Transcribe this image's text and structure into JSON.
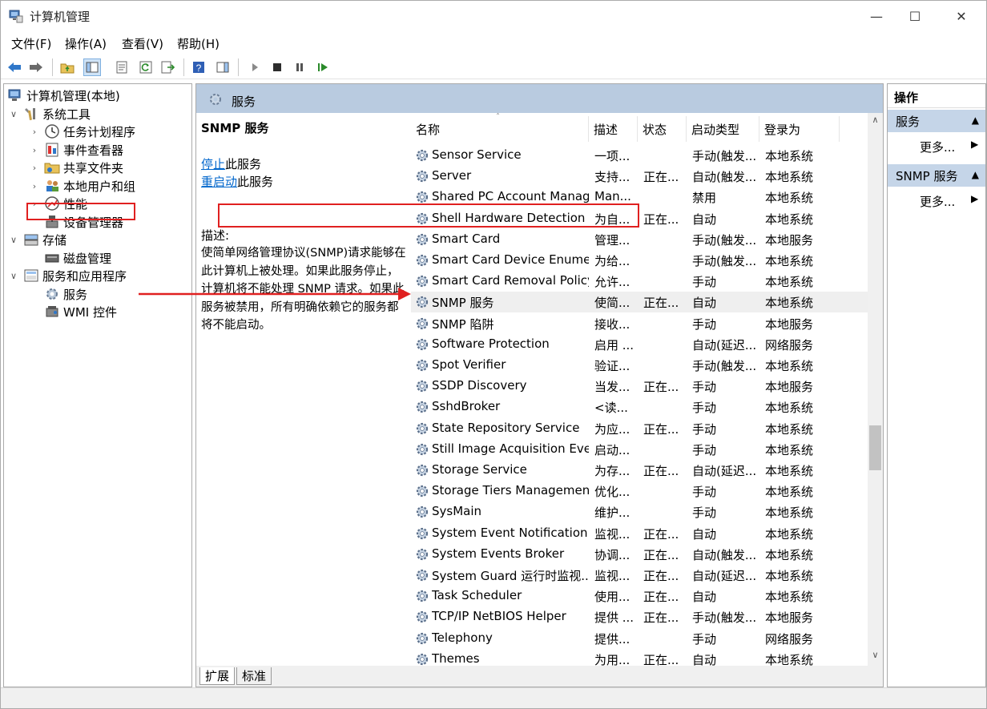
{
  "window": {
    "title": "计算机管理",
    "minimize": "—",
    "maximize": "☐",
    "close": "✕"
  },
  "menu": [
    "文件(F)",
    "操作(A)",
    "查看(V)",
    "帮助(H)"
  ],
  "tree": {
    "root": "计算机管理(本地)",
    "system_tools": "系统工具",
    "task_scheduler": "任务计划程序",
    "event_viewer": "事件查看器",
    "shared_folders": "共享文件夹",
    "local_users": "本地用户和组",
    "performance": "性能",
    "device_manager": "设备管理器",
    "storage": "存储",
    "disk_management": "磁盘管理",
    "services_apps": "服务和应用程序",
    "services": "服务",
    "wmi": "WMI 控件"
  },
  "center": {
    "header": "服务",
    "service_name": "SNMP 服务",
    "stop_link": "停止",
    "stop_rest": "此服务",
    "restart_link": "重启动",
    "restart_rest": "此服务",
    "desc_label": "描述:",
    "description": "使简单网络管理协议(SNMP)请求能够在此计算机上被处理。如果此服务停止，计算机将不能处理 SNMP 请求。如果此服务被禁用，所有明确依赖它的服务都将不能启动。"
  },
  "columns": [
    "名称",
    "描述",
    "状态",
    "启动类型",
    "登录为"
  ],
  "services": [
    [
      "Sensor Service",
      "一项...",
      "",
      "手动(触发...",
      "本地系统"
    ],
    [
      "Server",
      "支持...",
      "正在...",
      "自动(触发...",
      "本地系统"
    ],
    [
      "Shared PC Account Manager",
      "Man...",
      "",
      "禁用",
      "本地系统"
    ],
    [
      "Shell Hardware Detection",
      "为自...",
      "正在...",
      "自动",
      "本地系统"
    ],
    [
      "Smart Card",
      "管理...",
      "",
      "手动(触发...",
      "本地服务"
    ],
    [
      "Smart Card Device Enumer...",
      "为给...",
      "",
      "手动(触发...",
      "本地系统"
    ],
    [
      "Smart Card Removal Policy",
      "允许...",
      "",
      "手动",
      "本地系统"
    ],
    [
      "SNMP 服务",
      "使简...",
      "正在...",
      "自动",
      "本地系统"
    ],
    [
      "SNMP 陷阱",
      "接收...",
      "",
      "手动",
      "本地服务"
    ],
    [
      "Software Protection",
      "启用 ...",
      "",
      "自动(延迟...",
      "网络服务"
    ],
    [
      "Spot Verifier",
      "验证...",
      "",
      "手动(触发...",
      "本地系统"
    ],
    [
      "SSDP Discovery",
      "当发...",
      "正在...",
      "手动",
      "本地服务"
    ],
    [
      "SshdBroker",
      "<读...",
      "",
      "手动",
      "本地系统"
    ],
    [
      "State Repository Service",
      "为应...",
      "正在...",
      "手动",
      "本地系统"
    ],
    [
      "Still Image Acquisition Eve...",
      "启动...",
      "",
      "手动",
      "本地系统"
    ],
    [
      "Storage Service",
      "为存...",
      "正在...",
      "自动(延迟...",
      "本地系统"
    ],
    [
      "Storage Tiers Management",
      "优化...",
      "",
      "手动",
      "本地系统"
    ],
    [
      "SysMain",
      "维护...",
      "",
      "手动",
      "本地系统"
    ],
    [
      "System Event Notification ...",
      "监视...",
      "正在...",
      "自动",
      "本地系统"
    ],
    [
      "System Events Broker",
      "协调...",
      "正在...",
      "自动(触发...",
      "本地系统"
    ],
    [
      "System Guard 运行时监视...",
      "监视...",
      "正在...",
      "自动(延迟...",
      "本地系统"
    ],
    [
      "Task Scheduler",
      "使用...",
      "正在...",
      "自动",
      "本地系统"
    ],
    [
      "TCP/IP NetBIOS Helper",
      "提供 ...",
      "正在...",
      "手动(触发...",
      "本地服务"
    ],
    [
      "Telephony",
      "提供...",
      "",
      "手动",
      "网络服务"
    ],
    [
      "Themes",
      "为用...",
      "正在...",
      "自动",
      "本地系统"
    ]
  ],
  "selected_index": 7,
  "tabs": [
    "扩展",
    "标准"
  ],
  "actions": {
    "title": "操作",
    "group1": "服务",
    "group2": "SNMP 服务",
    "more": "更多..."
  },
  "colors": {
    "accent_header": "#b9cbe0",
    "action_group": "#c5d5e8",
    "annotation": "#e02020",
    "link": "#0066cc"
  }
}
